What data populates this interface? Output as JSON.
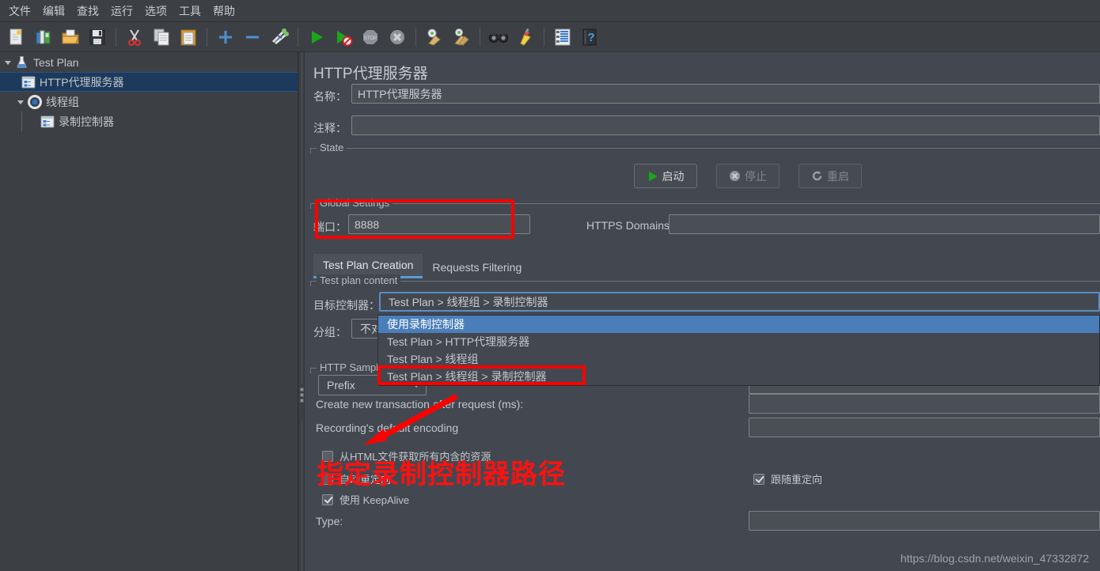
{
  "menubar": {
    "items": [
      {
        "label": "文件",
        "name": "menu-file"
      },
      {
        "label": "编辑",
        "name": "menu-edit"
      },
      {
        "label": "查找",
        "name": "menu-search"
      },
      {
        "label": "运行",
        "name": "menu-run"
      },
      {
        "label": "选项",
        "name": "menu-options"
      },
      {
        "label": "工具",
        "name": "menu-tools"
      },
      {
        "label": "帮助",
        "name": "menu-help"
      }
    ]
  },
  "toolbar": {
    "items": [
      {
        "icon": "new-file-icon",
        "tip": "新建"
      },
      {
        "icon": "templates-icon",
        "tip": "模板"
      },
      {
        "icon": "open-folder-icon",
        "tip": "打开"
      },
      {
        "icon": "save-icon",
        "tip": "保存"
      },
      {
        "icon": "separator",
        "tip": ""
      },
      {
        "icon": "cut-icon",
        "tip": "剪切"
      },
      {
        "icon": "copy-icon",
        "tip": "复制"
      },
      {
        "icon": "paste-icon",
        "tip": "粘贴"
      },
      {
        "icon": "separator",
        "tip": ""
      },
      {
        "icon": "plus-icon",
        "tip": "展开全部"
      },
      {
        "icon": "minus-icon",
        "tip": "收起全部"
      },
      {
        "icon": "toggle-icon",
        "tip": "切换"
      },
      {
        "icon": "separator",
        "tip": ""
      },
      {
        "icon": "start-icon",
        "tip": "启动"
      },
      {
        "icon": "start-no-pauses-icon",
        "tip": "无暂停启动"
      },
      {
        "icon": "stop-icon",
        "tip": "停止"
      },
      {
        "icon": "shutdown-icon",
        "tip": "关闭"
      },
      {
        "icon": "separator",
        "tip": ""
      },
      {
        "icon": "clear-icon",
        "tip": "清除"
      },
      {
        "icon": "clear-all-icon",
        "tip": "清除全部"
      },
      {
        "icon": "separator",
        "tip": ""
      },
      {
        "icon": "search-icon",
        "tip": "查找"
      },
      {
        "icon": "reset-search-icon",
        "tip": "重置查找"
      },
      {
        "icon": "separator",
        "tip": ""
      },
      {
        "icon": "function-helper-icon",
        "tip": "函数助手"
      },
      {
        "icon": "help-icon",
        "tip": "帮助"
      }
    ]
  },
  "tree": {
    "nodes": [
      {
        "label": "Test Plan",
        "icon": "test-plan-icon",
        "depth": 0,
        "expander": "expanded",
        "selected": false,
        "name": "tree-node-test-plan"
      },
      {
        "label": "HTTP代理服务器",
        "icon": "http-proxy-icon",
        "depth": 1,
        "expander": "none",
        "selected": true,
        "name": "tree-node-http-proxy-server"
      },
      {
        "label": "线程组",
        "icon": "thread-group-icon",
        "depth": 1,
        "expander": "expanded",
        "selected": false,
        "name": "tree-node-thread-group"
      },
      {
        "label": "录制控制器",
        "icon": "recording-controller-icon",
        "depth": 2,
        "expander": "none",
        "selected": false,
        "name": "tree-node-recording-controller"
      }
    ]
  },
  "main": {
    "title": "HTTP代理服务器",
    "name_label": "名称：",
    "name_value": "HTTP代理服务器",
    "comment_label": "注释：",
    "comment_value": "",
    "state_group": "State",
    "buttons": {
      "start": "启动",
      "stop": "停止",
      "restart": "重启"
    },
    "global_settings_group": "Global Settings",
    "port_label": "端口：",
    "port_value": "8888",
    "https_domains_label": "HTTPS Domains:",
    "https_domains_value": "",
    "tabs": [
      {
        "label": "Test Plan Creation",
        "active": true,
        "name": "tab-test-plan-creation"
      },
      {
        "label": "Requests Filtering",
        "active": false,
        "name": "tab-requests-filtering"
      }
    ],
    "test_plan_content_group": "Test plan content",
    "target_controller_label": "目标控制器：",
    "target_controller_value": "Test Plan > 线程组 > 录制控制器",
    "grouping_label": "分组：",
    "grouping_value": "不对",
    "http_sampler_group": "HTTP Sample",
    "prefix_value": "Prefix",
    "create_transaction_label": "Create new transaction after request (ms):",
    "create_transaction_value": "",
    "recording_encoding_label": "Recording's default encoding",
    "recording_encoding_value": "",
    "type_label": "Type:",
    "type_value": "",
    "checkboxes": [
      {
        "label": "从HTML文件获取所有内含的资源",
        "checked": false,
        "name": "checkbox-retrieve-embedded-resources"
      },
      {
        "label": "自动重定向",
        "checked": false,
        "name": "checkbox-redirect-automatically"
      },
      {
        "label": "使用 KeepAlive",
        "checked": true,
        "name": "checkbox-use-keepalive"
      },
      {
        "label": "跟随重定向",
        "checked": true,
        "name": "checkbox-follow-redirects"
      }
    ]
  },
  "dropdown": {
    "open": true,
    "items": [
      {
        "label": "使用录制控制器",
        "selected": true,
        "name": "dropdown-item-use-recording-controller"
      },
      {
        "label": "Test Plan > HTTP代理服务器",
        "selected": false,
        "name": "dropdown-item-http-proxy-server"
      },
      {
        "label": "Test Plan > 线程组",
        "selected": false,
        "name": "dropdown-item-thread-group"
      },
      {
        "label": "Test Plan > 线程组 > 录制控制器",
        "selected": false,
        "name": "dropdown-item-thread-group-recording-controller"
      }
    ]
  },
  "annotations": {
    "callout_text": "指定录制控制器路径",
    "color": "#ff0000"
  },
  "watermark": "https://blog.csdn.net/weixin_47332872"
}
